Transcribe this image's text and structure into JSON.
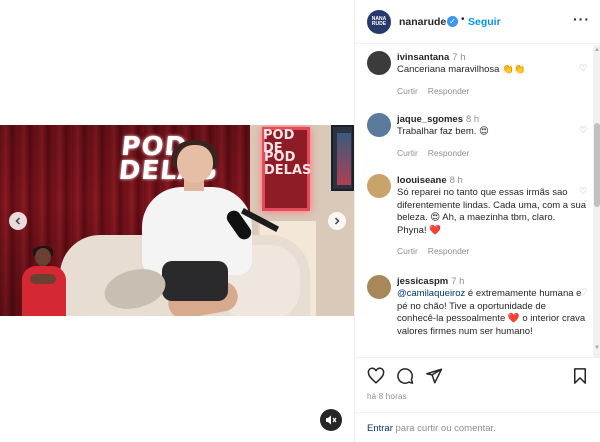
{
  "post": {
    "media": {
      "big_logo": [
        "POD",
        "DELAS"
      ],
      "small_logo": [
        "POD",
        "DE"
      ],
      "small_logo2": [
        "POD",
        "DELAS"
      ],
      "prev_icon": "chevron-left-icon",
      "next_icon": "chevron-right-icon",
      "mute_icon": "speaker-muted-icon"
    },
    "header": {
      "avatar_text": [
        "NANA",
        "RUDE"
      ],
      "username": "nanarude",
      "verified_icon": "verified-badge-icon",
      "separator": "•",
      "follow_label": "Seguir",
      "more_icon": "more-options-icon"
    },
    "comments": [
      {
        "username": "ivinsantana",
        "time": "7 h",
        "text": "Canceriana maravilhosa 👏👏",
        "reply_label": "Responder",
        "like_label": "Curtir",
        "avatar_color": "#3b3b3b"
      },
      {
        "username": "jaque_sgomes",
        "time": "8 h",
        "text": "Trabalhar faz bem. 😍",
        "reply_label": "Responder",
        "like_label": "Curtir",
        "avatar_color": "#5b7a9c"
      },
      {
        "username": "loouiseane",
        "time": "8 h",
        "text": "Só reparei no tanto que essas irmãs sao diferentemente lindas. Cada uma, com a sua beleza. 😍 Ah, a maezinha tbm, claro. Phyna! ❤️",
        "reply_label": "Responder",
        "like_label": "Curtir",
        "avatar_color": "#c9a46a"
      },
      {
        "username": "jessicaspm",
        "time": "7 h",
        "mention": "@camilaqueiroz",
        "text": " é extremamente humana e pé no chão! Tive a oportunidade de conhecê-la pessoalmente ❤️  o interior crava valores firmes num ser humano!",
        "reply_label": "Responder",
        "like_label": "Curtir",
        "avatar_color": "#a8885a"
      }
    ],
    "actions": {
      "like_icon": "heart-icon",
      "comment_icon": "comment-icon",
      "share_icon": "send-icon",
      "save_icon": "bookmark-icon"
    },
    "time_ago": "há 8 horas",
    "login": {
      "link": "Entrar",
      "rest": " para curtir ou comentar."
    }
  },
  "colors": {
    "accent": "#0095f6",
    "link": "#00376b",
    "muted": "#8e8e8e",
    "heart": "#ed4956"
  }
}
